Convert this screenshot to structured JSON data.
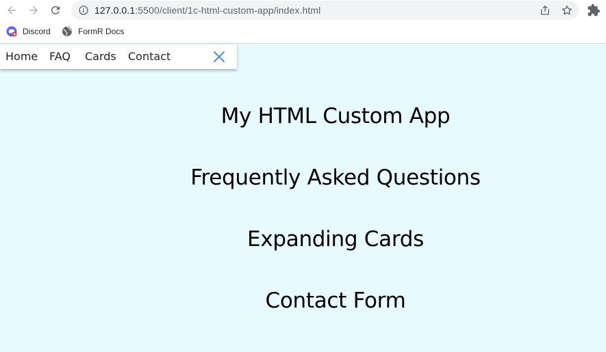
{
  "browser": {
    "url_host": "127.0.0.1",
    "url_path": ":5500/client/1c-html-custom-app/index.html",
    "icons": {
      "back": "arrow-left-icon",
      "forward": "arrow-right-icon",
      "reload": "reload-icon",
      "info": "info-icon",
      "share": "share-icon",
      "bookmark_star": "star-icon",
      "extensions": "puzzle-icon"
    }
  },
  "bookmarks": [
    {
      "label": "Discord",
      "icon": "discord-icon"
    },
    {
      "label": "FormR Docs",
      "icon": "globe-icon"
    }
  ],
  "navbar": {
    "links": [
      "Home",
      "FAQ",
      "Cards",
      "Contact"
    ],
    "close_icon": "close-icon",
    "accent_color": "#4a90d9"
  },
  "sections": [
    "My HTML Custom App",
    "Frequently Asked Questions",
    "Expanding Cards",
    "Contact Form"
  ],
  "colors": {
    "page_background": "#e6faff",
    "text": "#000000"
  }
}
